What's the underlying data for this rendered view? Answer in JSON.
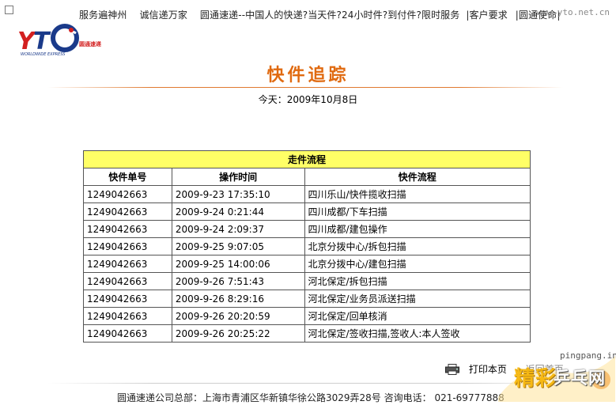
{
  "top_nav": {
    "items": [
      "服务遍神州",
      "诚信递万家",
      "圆通速递--中国人的快递?当天件?24小时件?到付件?限时服务",
      "|客户要求",
      "|圆通使命|"
    ],
    "site_url": "www.yto.net.cn"
  },
  "logo": {
    "text": "YTO",
    "tagline": "WORLDWIDE EXPRESS",
    "cn": "圆通速递"
  },
  "page": {
    "title": "快件追踪",
    "date_line": "今天：2009年10月8日"
  },
  "table": {
    "caption": "走件流程",
    "columns": [
      "快件单号",
      "操作时间",
      "快件流程"
    ],
    "rows": [
      [
        "1249042663",
        "2009-9-23 17:35:10",
        "四川乐山/快件揽收扫描"
      ],
      [
        "1249042663",
        "2009-9-24 0:21:44",
        "四川成都/下车扫描"
      ],
      [
        "1249042663",
        "2009-9-24 2:09:37",
        "四川成都/建包操作"
      ],
      [
        "1249042663",
        "2009-9-25 9:07:05",
        "北京分拨中心/拆包扫描"
      ],
      [
        "1249042663",
        "2009-9-25 14:00:06",
        "北京分拨中心/建包扫描"
      ],
      [
        "1249042663",
        "2009-9-26 7:51:43",
        "河北保定/拆包扫描"
      ],
      [
        "1249042663",
        "2009-9-26 8:29:16",
        "河北保定/业务员派送扫描"
      ],
      [
        "1249042663",
        "2009-9-26 20:20:59",
        "河北保定/回单核消"
      ],
      [
        "1249042663",
        "2009-9-26 20:25:22",
        "河北保定/签收扫描,签收人:本人签收"
      ]
    ]
  },
  "actions": {
    "print_label": "打印本页",
    "back_label": "返回首页"
  },
  "footer": {
    "text": "圆通速递公司总部：上海市青浦区华新镇华徐公路3029弄28号 咨询电话： 021-69777888"
  },
  "watermark": {
    "url": "pingpang.info",
    "text1": "精彩",
    "text2": "乒乓网"
  },
  "colors": {
    "title": "#e06a10",
    "caption_bg": "#ffff66",
    "logo_blue": "#1a3a8a",
    "logo_red": "#d32020"
  }
}
